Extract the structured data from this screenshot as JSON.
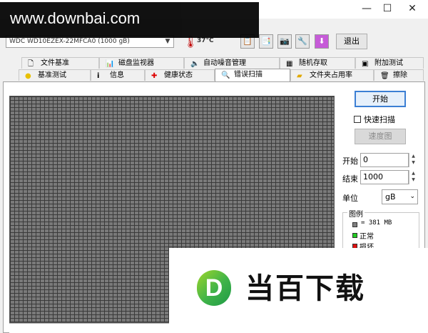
{
  "watermark": {
    "site": "www.downbai.com",
    "brand_letter": "D",
    "brand_text": "当百下载"
  },
  "window": {
    "controls": {
      "minimize": "—",
      "maximize": "☐",
      "close": "✕"
    }
  },
  "toolbar": {
    "drive": "WDC WD10EZEX-22MFCA0 (1000 gB)",
    "temperature": "37°C",
    "exit_label": "退出"
  },
  "tabs_row1": [
    {
      "label": "文件基准",
      "icon": "file-icon"
    },
    {
      "label": "磁盘监视器",
      "icon": "monitor-chart-icon"
    },
    {
      "label": "自动噪音管理",
      "icon": "speaker-icon"
    },
    {
      "label": "随机存取",
      "icon": "access-icon"
    },
    {
      "label": "附加测试",
      "icon": "extra-icon"
    }
  ],
  "tabs_row2": [
    {
      "label": "基准测试",
      "icon": "bulb-icon"
    },
    {
      "label": "信息",
      "icon": "info-icon"
    },
    {
      "label": "健康状态",
      "icon": "health-cross-icon"
    },
    {
      "label": "错误扫描",
      "icon": "magnifier-icon",
      "active": true
    },
    {
      "label": "文件夹占用率",
      "icon": "folder-icon"
    },
    {
      "label": "擦除",
      "icon": "trash-icon"
    }
  ],
  "scan": {
    "start_label": "开始",
    "quick_label": "快速扫描",
    "speed_label": "速度图",
    "start_field_label": "开始",
    "start_value": "0",
    "end_field_label": "结束",
    "end_value": "1000",
    "unit_label": "单位",
    "unit_value": "gB"
  },
  "legend": {
    "title": "图例",
    "block_size": "= 381 MB",
    "ok": "正常",
    "bad": "损坏"
  },
  "colors": {
    "ok": "#22cc22",
    "bad": "#dd1111",
    "block": "#808080",
    "accent": "#3c7fd4"
  }
}
